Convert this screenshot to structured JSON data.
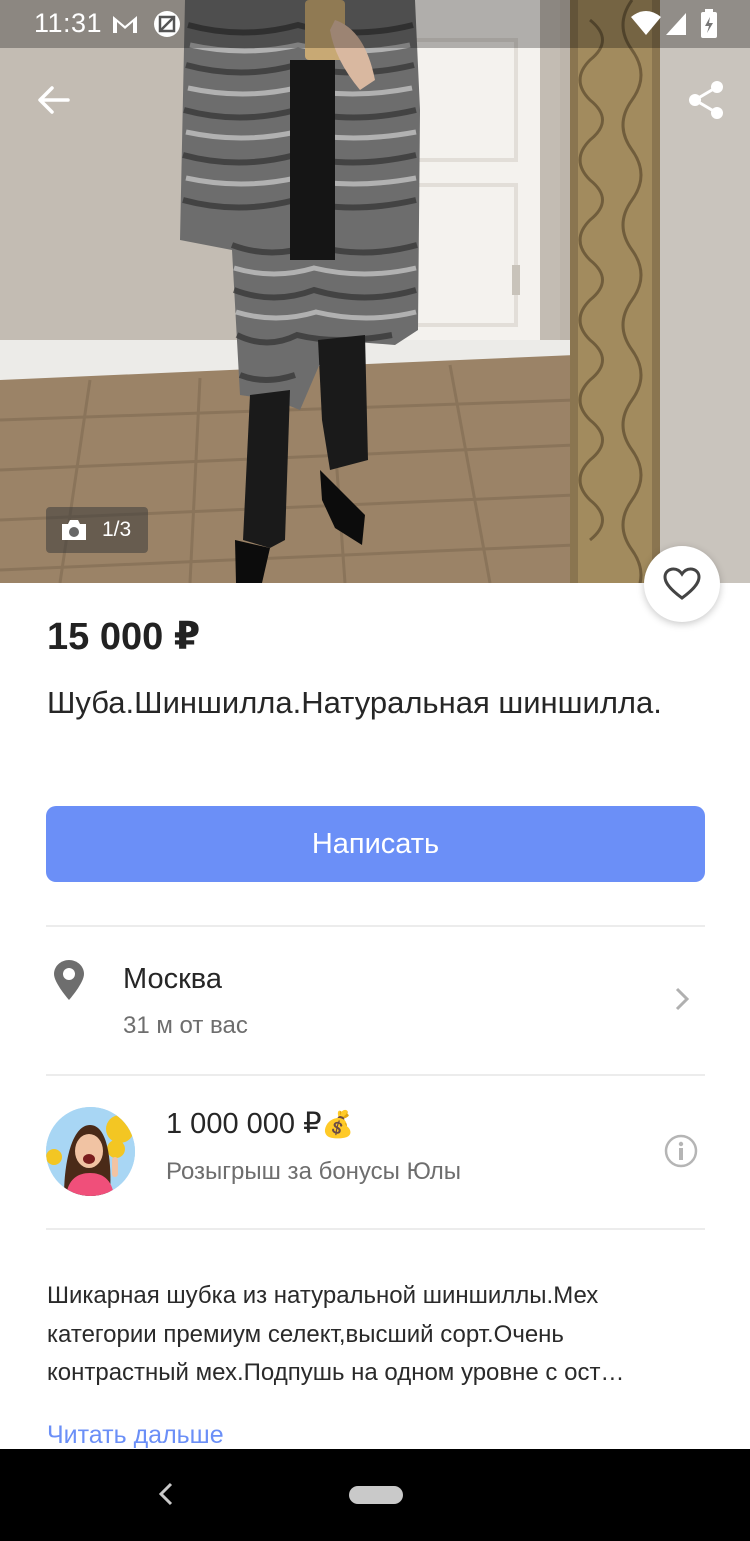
{
  "status_bar": {
    "time": "11:31",
    "left_icons": [
      "gmail-icon",
      "app-icon"
    ],
    "right_icons": [
      "wifi-icon",
      "signal-icon",
      "battery-icon"
    ]
  },
  "photo": {
    "counter": "1/3",
    "current": 1,
    "total": 3
  },
  "listing": {
    "price": "15 000 ₽",
    "title": "Шуба.Шиншилла.Натуральная шиншилла.",
    "write_label": "Написать"
  },
  "location": {
    "city": "Москва",
    "distance": "31 м от вас"
  },
  "promo": {
    "amount": "1 000 000 ₽",
    "emoji": "💰",
    "subtitle": "Розыгрыш за бонусы Юлы"
  },
  "description": {
    "lines": [
      "Шикарная шубка из натуральной шиншиллы.Мех",
      "категории премиум селект,высший сорт.Очень",
      "контрастный мех.Подпушь на одном уровне с ост…"
    ],
    "more_label": "Читать дальше"
  },
  "colors": {
    "accent": "#6b8ff7",
    "text_primary": "#262626",
    "text_secondary": "#6e6e6e",
    "divider": "#ececec"
  }
}
